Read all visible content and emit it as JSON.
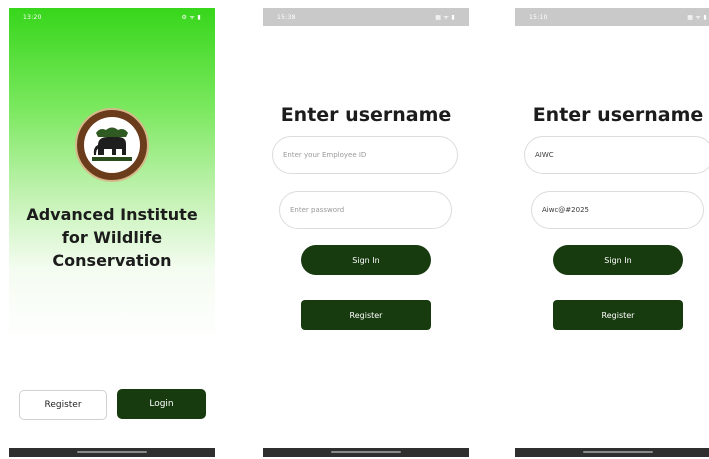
{
  "screen_welcome": {
    "status_time": "13:20",
    "status_icons": "⚙ ᯤ ▮",
    "title_lines": [
      "Advanced Institute",
      "for Wildlife",
      "Conservation"
    ],
    "logo_icon": "elephant-emblem",
    "register_label": "Register",
    "login_label": "Login"
  },
  "screen_login_empty": {
    "status_time": "15:38",
    "status_icons": "▦ ᯤ ▮",
    "heading": "Enter username",
    "employee_id_placeholder": "Enter your Employee ID",
    "password_placeholder": "Enter password",
    "signin_label": "Sign In",
    "register_label": "Register"
  },
  "screen_login_filled": {
    "status_time": "15:10",
    "status_icons": "▦ ᯤ ▮",
    "heading": "Enter username",
    "employee_id_value": "AIWC",
    "password_value": "Aiwc@#2025",
    "signin_label": "Sign In",
    "register_label": "Register"
  },
  "colors": {
    "primary_dark_green": "#173a0f",
    "gradient_top_green": "#37d61b",
    "logo_ring_brown": "#6b3c1c"
  }
}
